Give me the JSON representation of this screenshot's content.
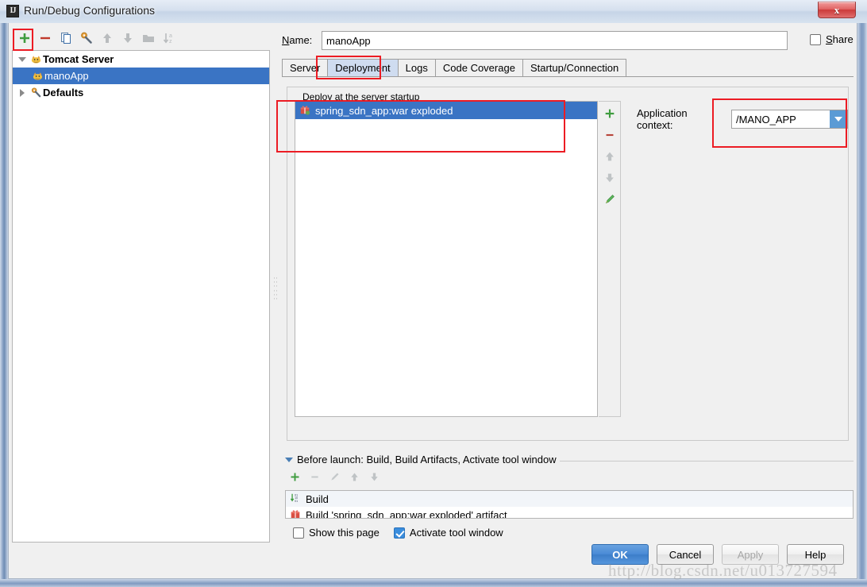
{
  "window": {
    "title": "Run/Debug Configurations",
    "app_icon": "IJ",
    "close_label": "x"
  },
  "left_toolbar": {
    "buttons": [
      {
        "name": "add",
        "icon": "plus-icon",
        "tooltip": "Add New Configuration"
      },
      {
        "name": "remove",
        "icon": "minus-icon",
        "tooltip": "Remove Configuration"
      },
      {
        "name": "copy",
        "icon": "copy-icon",
        "tooltip": "Copy Configuration"
      },
      {
        "name": "edit-defaults",
        "icon": "wrench-icon",
        "tooltip": "Edit defaults"
      },
      {
        "name": "move-up",
        "icon": "arrow-up-icon",
        "tooltip": "Move Up"
      },
      {
        "name": "move-down",
        "icon": "arrow-down-icon",
        "tooltip": "Move Down"
      },
      {
        "name": "new-folder",
        "icon": "folder-icon",
        "tooltip": "Create New Folder"
      },
      {
        "name": "sort",
        "icon": "sort-alpha-icon",
        "tooltip": "Sort Configurations"
      }
    ]
  },
  "tree": {
    "nodes": [
      {
        "label": "Tomcat Server",
        "icon": "tomcat-icon",
        "level": 0,
        "expanded": true,
        "selected": false
      },
      {
        "label": "manoApp",
        "icon": "tomcat-icon",
        "level": 1,
        "expanded": null,
        "selected": true
      },
      {
        "label": "Defaults",
        "icon": "wrench-icon",
        "level": 0,
        "expanded": false,
        "selected": false
      }
    ]
  },
  "name_row": {
    "label": "Name:",
    "label_mnemonic": "N",
    "value": "manoApp",
    "placeholder": "",
    "share_label": "Share",
    "share_mnemonic": "S",
    "share_checked": false
  },
  "tabs": [
    {
      "label": "Server",
      "selected": false
    },
    {
      "label": "Deployment",
      "selected": true
    },
    {
      "label": "Logs",
      "selected": false
    },
    {
      "label": "Code Coverage",
      "selected": false
    },
    {
      "label": "Startup/Connection",
      "selected": false
    }
  ],
  "deployment": {
    "group_title": "Deploy at the server startup",
    "artifacts": [
      {
        "label": "spring_sdn_app:war exploded",
        "icon": "artifact-icon",
        "selected": true
      }
    ],
    "vertical_toolbar": [
      {
        "name": "add-artifact",
        "icon": "plus-icon",
        "enabled": true
      },
      {
        "name": "remove-artifact",
        "icon": "minus-icon",
        "enabled": true
      },
      {
        "name": "move-artifact-up",
        "icon": "arrow-up-icon",
        "enabled": false
      },
      {
        "name": "move-artifact-down",
        "icon": "arrow-down-icon",
        "enabled": false
      },
      {
        "name": "edit-artifact",
        "icon": "pencil-icon",
        "enabled": true
      }
    ],
    "application_context_label": "Application context:",
    "application_context_value": "/MANO_APP"
  },
  "before_launch": {
    "header": "Before launch: Build, Build Artifacts, Activate tool window",
    "header_mnemonic": "B",
    "toolbar": [
      {
        "name": "add-task",
        "icon": "plus-icon",
        "enabled": true
      },
      {
        "name": "remove-task",
        "icon": "minus-icon",
        "enabled": false
      },
      {
        "name": "edit-task",
        "icon": "pencil-icon",
        "enabled": false
      },
      {
        "name": "move-task-up",
        "icon": "arrow-up-icon",
        "enabled": false
      },
      {
        "name": "move-task-down",
        "icon": "arrow-down-icon",
        "enabled": false
      }
    ],
    "tasks": [
      {
        "label": "Build",
        "icon": "build-icon"
      },
      {
        "label": "Build 'spring_sdn_app:war exploded' artifact",
        "icon": "artifact-icon"
      }
    ],
    "show_this_page_label": "Show this page",
    "show_this_page_checked": false,
    "activate_tool_window_label": "Activate tool window",
    "activate_tool_window_checked": true
  },
  "buttons": {
    "ok": "OK",
    "cancel": "Cancel",
    "apply": "Apply",
    "help": "Help",
    "apply_enabled": false
  },
  "watermark": "http://blog.csdn.net/u013727594",
  "colors": {
    "selection_blue": "#3a74c4",
    "annotation_red": "#ec1c24",
    "accent_green": "#3f9c3f",
    "accent_red": "#c0392b",
    "default_button_blue": "#4a8bd6",
    "tab_selected": "#cfdcf0"
  }
}
